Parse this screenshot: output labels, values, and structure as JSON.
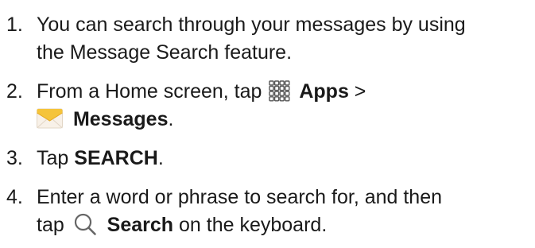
{
  "steps": [
    {
      "number": "1.",
      "line1": "You can search through your messages by using",
      "line2": "the Message Search feature."
    },
    {
      "number": "2.",
      "prefix": "From a Home screen, tap",
      "apps_label": "Apps",
      "separator": ">",
      "messages_label": "Messages",
      "suffix": ".",
      "apps_icon": "apps-grid-icon",
      "messages_icon": "envelope-icon"
    },
    {
      "number": "3.",
      "prefix": "Tap",
      "bold": "SEARCH",
      "suffix": "."
    },
    {
      "number": "4.",
      "line1": "Enter a word or phrase to search for, and then",
      "prefix2": "tap",
      "bold": "Search",
      "suffix2": "on the keyboard.",
      "search_icon": "magnifier-icon"
    }
  ],
  "colors": {
    "text": "#1a1a1a",
    "envelope_top": "#f5c43a",
    "envelope_body": "#f8f1e8"
  }
}
